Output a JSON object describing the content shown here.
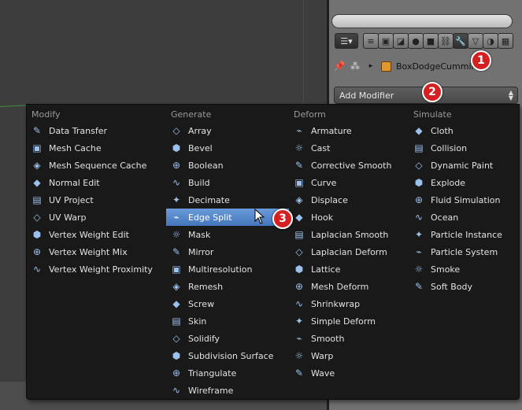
{
  "header": {
    "object_name": "BoxDodgeCummin",
    "add_modifier_label": "Add Modifier"
  },
  "property_tabs": [
    {
      "name": "render-layers-icon",
      "glyph": "≡"
    },
    {
      "name": "render-icon",
      "glyph": "▣"
    },
    {
      "name": "scene-icon",
      "glyph": "◪"
    },
    {
      "name": "world-icon",
      "glyph": "●"
    },
    {
      "name": "object-icon",
      "glyph": "■"
    },
    {
      "name": "constraints-icon",
      "glyph": "⛓"
    },
    {
      "name": "modifiers-wrench-icon",
      "glyph": "🔧"
    },
    {
      "name": "data-icon",
      "glyph": "▽"
    },
    {
      "name": "material-icon",
      "glyph": "◑"
    },
    {
      "name": "texture-icon",
      "glyph": "▦"
    }
  ],
  "menu": {
    "columns": [
      {
        "title": "Modify",
        "items": [
          "Data Transfer",
          "Mesh Cache",
          "Mesh Sequence Cache",
          "Normal Edit",
          "UV Project",
          "UV Warp",
          "Vertex Weight Edit",
          "Vertex Weight Mix",
          "Vertex Weight Proximity"
        ]
      },
      {
        "title": "Generate",
        "items": [
          "Array",
          "Bevel",
          "Boolean",
          "Build",
          "Decimate",
          "Edge Split",
          "Mask",
          "Mirror",
          "Multiresolution",
          "Remesh",
          "Screw",
          "Skin",
          "Solidify",
          "Subdivision Surface",
          "Triangulate",
          "Wireframe"
        ]
      },
      {
        "title": "Deform",
        "items": [
          "Armature",
          "Cast",
          "Corrective Smooth",
          "Curve",
          "Displace",
          "Hook",
          "Laplacian Smooth",
          "Laplacian Deform",
          "Lattice",
          "Mesh Deform",
          "Shrinkwrap",
          "Simple Deform",
          "Smooth",
          "Warp",
          "Wave"
        ]
      },
      {
        "title": "Simulate",
        "items": [
          "Cloth",
          "Collision",
          "Dynamic Paint",
          "Explode",
          "Fluid Simulation",
          "Ocean",
          "Particle Instance",
          "Particle System",
          "Smoke",
          "Soft Body"
        ]
      }
    ],
    "highlighted": "Edge Split"
  },
  "badges": [
    "1",
    "2",
    "3"
  ],
  "colors": {
    "badge": "#d42020",
    "highlight": "#5a8ad0"
  }
}
